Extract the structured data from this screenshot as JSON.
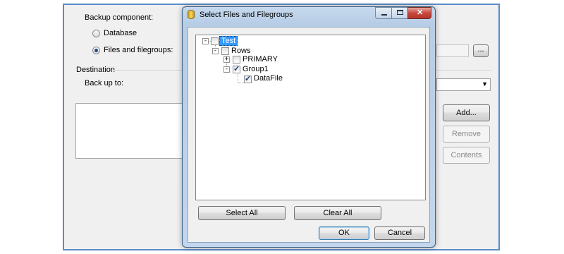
{
  "background_window": {
    "backup_component_label": "Backup component:",
    "radio_database_label": "Database",
    "radio_files_label": "Files and filegroups:",
    "radio_database_selected": false,
    "radio_files_selected": true,
    "browse_button_label": "...",
    "destination_label": "Destination",
    "back_up_to_label": "Back up to:",
    "add_button_label": "Add...",
    "remove_button_label": "Remove",
    "contents_button_label": "Contents"
  },
  "dialog": {
    "title": "Select Files and Filegroups",
    "tree": [
      {
        "label": "Test",
        "checked": false,
        "selected": true,
        "expander": "-"
      },
      {
        "label": "Rows",
        "checked": false,
        "expander": "-"
      },
      {
        "label": "PRIMARY",
        "checked": false,
        "expander": "+"
      },
      {
        "label": "Group1",
        "checked": true,
        "expander": "-"
      },
      {
        "label": "DataFile",
        "checked": true,
        "expander": ""
      }
    ],
    "select_all_label": "Select All",
    "clear_all_label": "Clear All",
    "ok_label": "OK",
    "cancel_label": "Cancel"
  },
  "colors": {
    "selection_highlight": "#3399ff",
    "window_border": "#5b8cc9",
    "close_button": "#c9473f"
  }
}
